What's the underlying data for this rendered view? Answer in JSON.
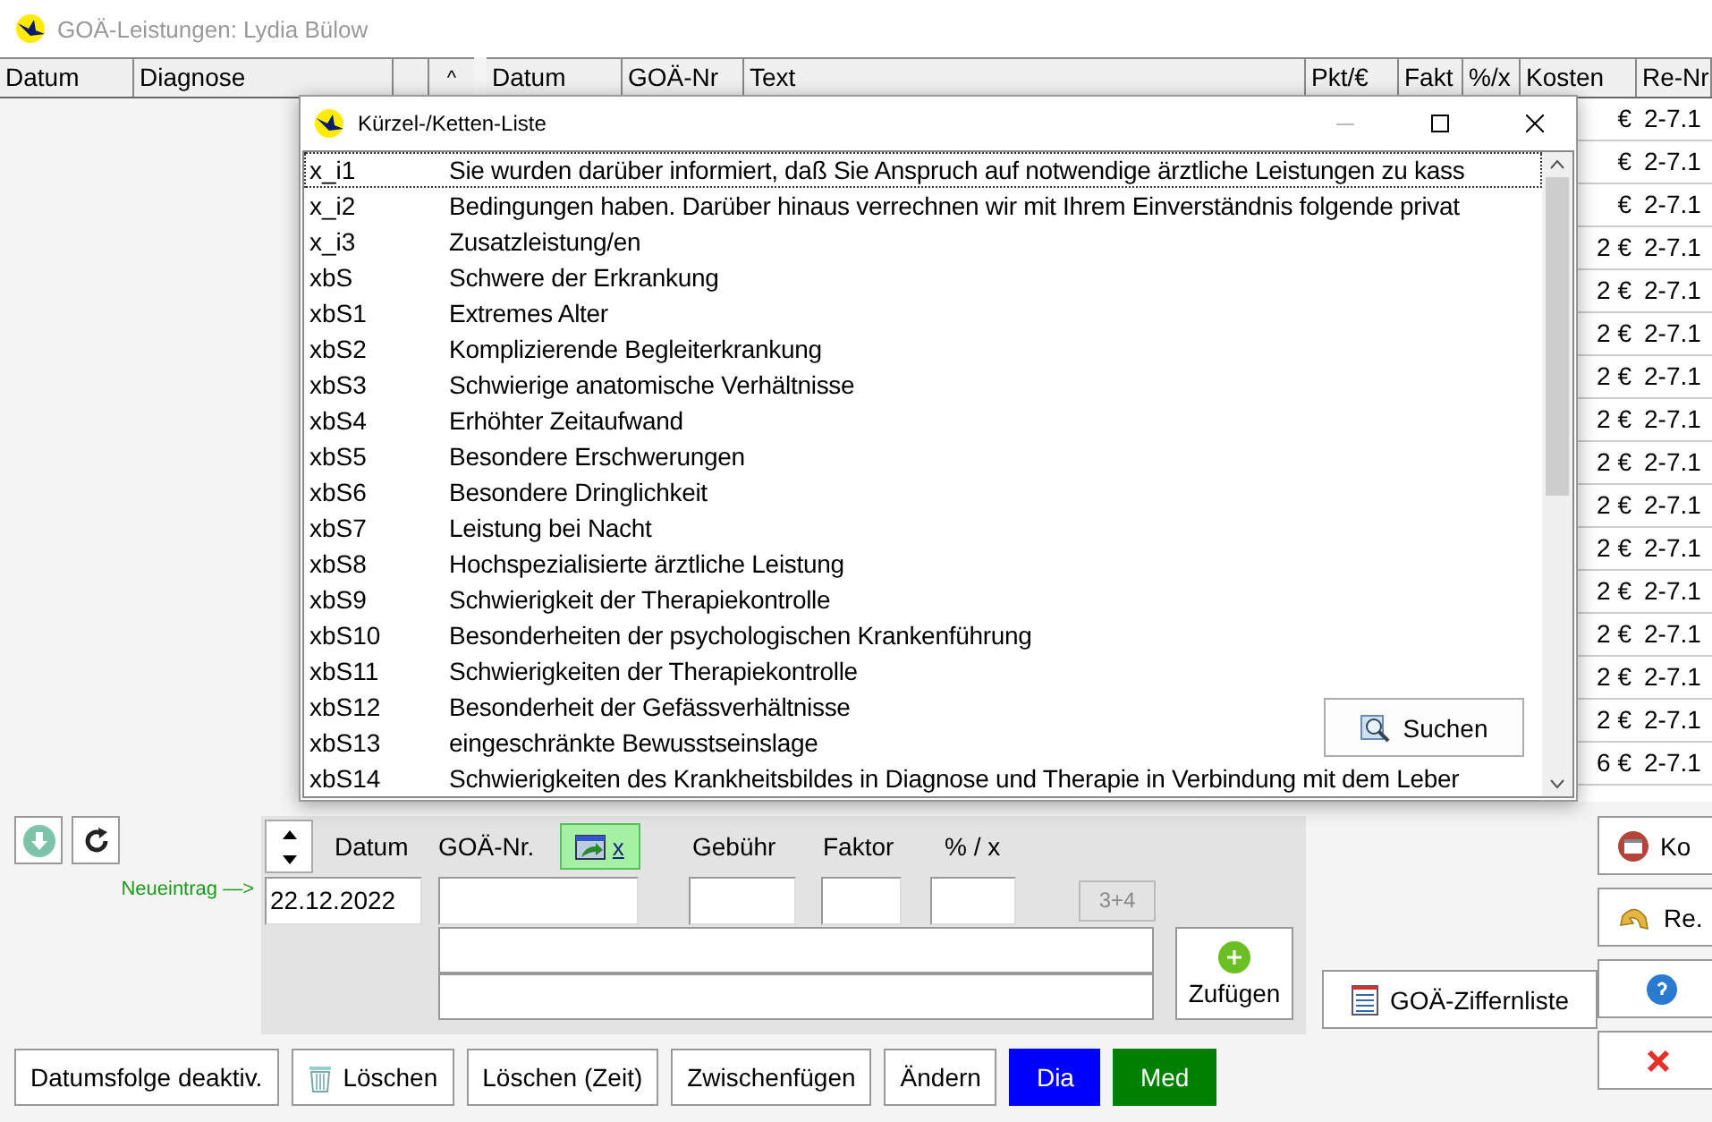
{
  "window": {
    "title": "GOÄ-Leistungen: Lydia Bülow"
  },
  "diagnosis_table": {
    "columns": [
      "Datum",
      "Diagnose"
    ],
    "sort_button": "^"
  },
  "services_table": {
    "columns": [
      "Datum",
      "GOÄ-Nr",
      "Text",
      "Pkt/€",
      "Fakt",
      "%/x",
      "Kosten",
      "Re-Nr"
    ],
    "rows": [
      {
        "kosten": "€",
        "re_nr": "2-7.1"
      },
      {
        "kosten": "€",
        "re_nr": "2-7.1"
      },
      {
        "kosten": "€",
        "re_nr": "2-7.1"
      },
      {
        "kosten": "2 €",
        "re_nr": "2-7.1"
      },
      {
        "kosten": "2 €",
        "re_nr": "2-7.1"
      },
      {
        "kosten": "2 €",
        "re_nr": "2-7.1"
      },
      {
        "kosten": "2 €",
        "re_nr": "2-7.1"
      },
      {
        "kosten": "2 €",
        "re_nr": "2-7.1"
      },
      {
        "kosten": "2 €",
        "re_nr": "2-7.1"
      },
      {
        "kosten": "2 €",
        "re_nr": "2-7.1"
      },
      {
        "kosten": "2 €",
        "re_nr": "2-7.1"
      },
      {
        "kosten": "2 €",
        "re_nr": "2-7.1"
      },
      {
        "kosten": "2 €",
        "re_nr": "2-7.1"
      },
      {
        "kosten": "2 €",
        "re_nr": "2-7.1"
      },
      {
        "kosten": "2 €",
        "re_nr": "2-7.1"
      },
      {
        "kosten": "6 €",
        "re_nr": "2-7.1"
      }
    ]
  },
  "dialog": {
    "title": "Kürzel-/Ketten-Liste",
    "search_button": "Suchen",
    "items": [
      {
        "code": "x_i1",
        "text": "Sie wurden darüber informiert, daß Sie Anspruch auf notwendige ärztliche Leistungen zu kass",
        "selected": true
      },
      {
        "code": "x_i2",
        "text": "Bedingungen haben. Darüber hinaus verrechnen wir mit Ihrem Einverständnis folgende privat",
        "selected": false
      },
      {
        "code": "x_i3",
        "text": "Zusatzleistung/en",
        "selected": false
      },
      {
        "code": "xbS",
        "text": "Schwere der Erkrankung",
        "selected": false
      },
      {
        "code": "xbS1",
        "text": "Extremes Alter",
        "selected": false
      },
      {
        "code": "xbS2",
        "text": "Komplizierende Begleiterkrankung",
        "selected": false
      },
      {
        "code": "xbS3",
        "text": "Schwierige anatomische Verhältnisse",
        "selected": false
      },
      {
        "code": "xbS4",
        "text": "Erhöhter Zeitaufwand",
        "selected": false
      },
      {
        "code": "xbS5",
        "text": "Besondere Erschwerungen",
        "selected": false
      },
      {
        "code": "xbS6",
        "text": "Besondere Dringlichkeit",
        "selected": false
      },
      {
        "code": "xbS7",
        "text": "Leistung bei Nacht",
        "selected": false
      },
      {
        "code": "xbS8",
        "text": "Hochspezialisierte ärztliche Leistung",
        "selected": false
      },
      {
        "code": "xbS9",
        "text": "Schwierigkeit der Therapiekontrolle",
        "selected": false
      },
      {
        "code": "xbS10",
        "text": "Besonderheiten der psychologischen Krankenführung",
        "selected": false
      },
      {
        "code": "xbS11",
        "text": "Schwierigkeiten der Therapiekontrolle",
        "selected": false
      },
      {
        "code": "xbS12",
        "text": "Besonderheit der Gefässverhältnisse",
        "selected": false
      },
      {
        "code": "xbS13",
        "text": "eingeschränkte Bewusstseinslage",
        "selected": false
      },
      {
        "code": "xbS14",
        "text": "Schwierigkeiten des Krankheitsbildes in Diagnose und Therapie in Verbindung mit dem Leber",
        "selected": false
      }
    ]
  },
  "form": {
    "new_entry_label": "Neueintrag —>",
    "date_label": "Datum",
    "goae_label": "GOÄ-Nr.",
    "fee_label": "Gebühr",
    "factor_label": "Faktor",
    "percent_label": "% / x",
    "x_button": "x",
    "date": "22.12.2022",
    "calc_button": "3+4",
    "add_button": "Zufügen"
  },
  "buttons": [
    {
      "label": "Datumsfolge deaktiv.",
      "kind": "plain"
    },
    {
      "label": "Löschen",
      "kind": "delete"
    },
    {
      "label": "Löschen (Zeit)",
      "kind": "plain"
    },
    {
      "label": "Zwischenfügen",
      "kind": "plain"
    },
    {
      "label": "Ändern",
      "kind": "plain"
    },
    {
      "label": "Dia",
      "kind": "blue"
    },
    {
      "label": "Med",
      "kind": "green"
    }
  ],
  "list_button": "GOÄ-Ziffernliste",
  "side_buttons": [
    {
      "label": "Ko",
      "kind": "calendar"
    },
    {
      "label": "Re.",
      "kind": "undo"
    },
    {
      "kind": "help"
    },
    {
      "kind": "close"
    }
  ]
}
